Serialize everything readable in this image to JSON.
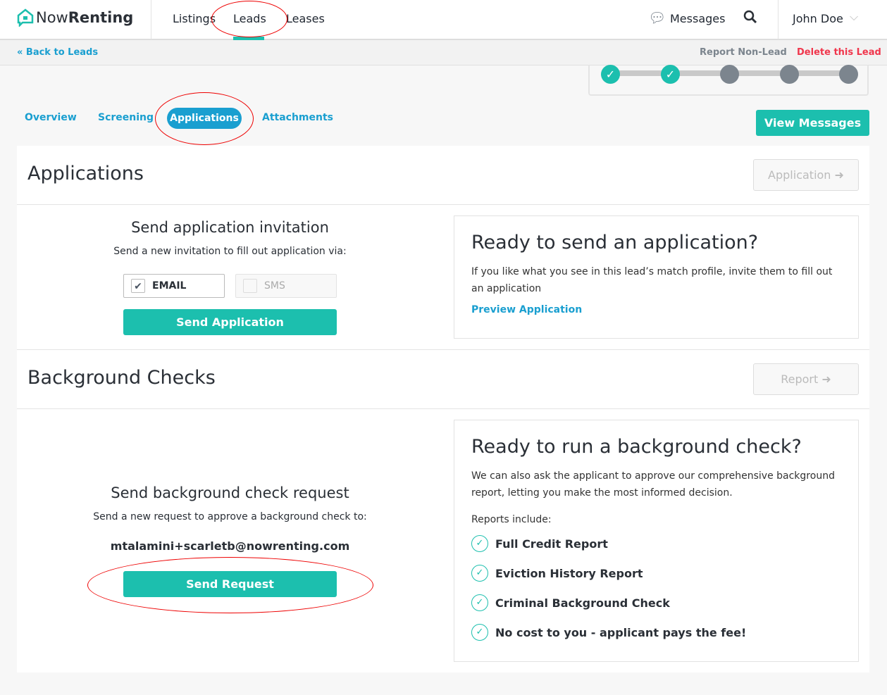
{
  "brand": {
    "name_light": "Now",
    "name_bold": "Renting"
  },
  "nav": {
    "listings": "Listings",
    "leads": "Leads",
    "leases": "Leases",
    "messages": "Messages",
    "user": "John Doe"
  },
  "subbar": {
    "back": "« Back to Leads",
    "report": "Report Non-Lead",
    "delete": "Delete this Lead"
  },
  "progress": {
    "steps_total": 5,
    "steps_done": 2
  },
  "tabs": {
    "overview": "Overview",
    "screening": "Screening",
    "applications": "Applications",
    "attachments": "Attachments",
    "active": "Applications"
  },
  "view_messages": "View Messages",
  "applications": {
    "title": "Applications",
    "header_button": "Application",
    "invite_title": "Send application invitation",
    "invite_sub": "Send a new invitation to fill out application via:",
    "email_label": "EMAIL",
    "email_checked": true,
    "sms_label": "SMS",
    "sms_checked": false,
    "send_button": "Send Application",
    "ready_title": "Ready to send an application?",
    "ready_text": "If you like what you see in this lead’s match profile, invite them to fill out an application",
    "preview_link": "Preview Application"
  },
  "background": {
    "title": "Background Checks",
    "header_button": "Report",
    "request_title": "Send background check request",
    "request_sub": "Send a new request to approve a background check to:",
    "email": "mtalamini+scarletb@nowrenting.com",
    "send_button": "Send Request",
    "ready_title": "Ready to run a background check?",
    "ready_text": "We can also ask the applicant to approve our comprehensive background report, letting you make the most informed decision.",
    "reports_label": "Reports include:",
    "reports": [
      "Full Credit Report",
      "Eviction History Report",
      "Criminal Background Check",
      "No cost to you - applicant pays the fee!"
    ]
  },
  "colors": {
    "accent": "#1cbfae",
    "link": "#1a9fd0",
    "danger": "#f0364c",
    "annotation": "#e00000"
  }
}
